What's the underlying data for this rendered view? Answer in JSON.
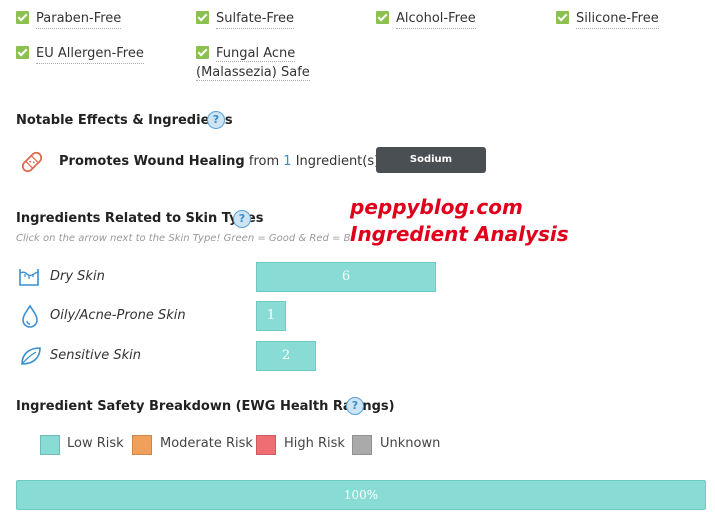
{
  "free_from": [
    {
      "label": "Paraben-Free"
    },
    {
      "label": "Sulfate-Free"
    },
    {
      "label": "Alcohol-Free"
    },
    {
      "label": "Silicone-Free"
    },
    {
      "label": "EU Allergen-Free"
    },
    {
      "label_line1": "Fungal Acne",
      "label_line2": "(Malassezia) Safe"
    }
  ],
  "notable": {
    "title": "Notable Effects & Ingredients",
    "help_icon": "?",
    "effect_name": "Promotes Wound Healing",
    "from_text": "from",
    "count": "1",
    "suffix": "Ingredient(s):",
    "ingredient_tag": "Sodium Hyaluronate",
    "icon": "bandage-icon"
  },
  "watermark": {
    "line1": "peppyblog.com",
    "line2": "Ingredient Analysis",
    "color": "#e0001b"
  },
  "skin_types": {
    "title": "Ingredients Related to Skin Types",
    "help_icon": "?",
    "subtitle": "Click on the arrow next to the Skin Type! Green = Good & Red = Bad",
    "rows": [
      {
        "label": "Dry Skin",
        "value": "6",
        "icon": "dry-skin-icon"
      },
      {
        "label": "Oily/Acne-Prone Skin",
        "value": "1",
        "icon": "oily-skin-icon"
      },
      {
        "label": "Sensitive Skin",
        "value": "2",
        "icon": "sensitive-skin-icon"
      }
    ],
    "bar_color": "#88dcd5"
  },
  "safety": {
    "title": "Ingredient Safety Breakdown (EWG Health Ratings)",
    "help_icon": "?",
    "legend": [
      {
        "label": "Low Risk",
        "color": "#88dcd5"
      },
      {
        "label": "Moderate Risk",
        "color": "#f0a05a"
      },
      {
        "label": "High Risk",
        "color": "#ee6e73"
      },
      {
        "label": "Unknown",
        "color": "#aaaaaa"
      }
    ],
    "bar_value": "100%",
    "low_risk_fraction": 1.0
  }
}
